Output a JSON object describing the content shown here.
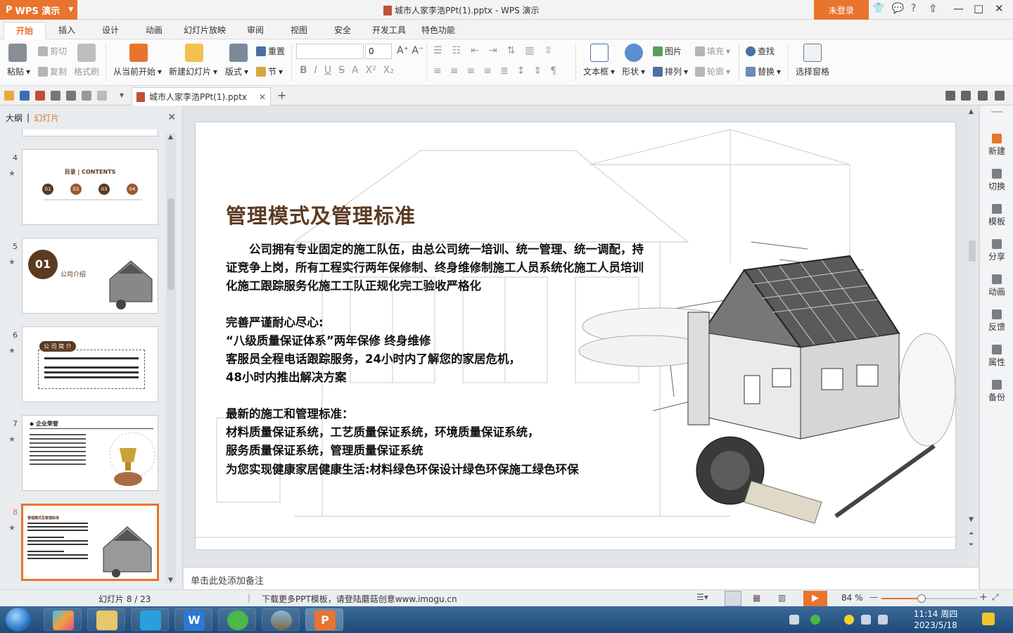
{
  "titlebar": {
    "app_name": "WPS 演示",
    "window_title": "城市人家李浩PPt(1).pptx - WPS 演示",
    "login_label": "未登录"
  },
  "tabs": [
    "开始",
    "插入",
    "设计",
    "动画",
    "幻灯片放映",
    "审阅",
    "视图",
    "安全",
    "开发工具",
    "特色功能"
  ],
  "ribbon": {
    "paste": "粘贴",
    "cut": "剪切",
    "copy": "复制",
    "format_painter": "格式刷",
    "from_current": "从当前开始",
    "new_slide": "新建幻灯片",
    "layout": "版式",
    "reset": "重置",
    "section": "节",
    "font_size": "0",
    "textbox": "文本框",
    "shape": "形状",
    "picture": "图片",
    "arrange": "排列",
    "fill": "填充",
    "outline": "轮廓",
    "find": "查找",
    "replace": "替换",
    "selection_pane": "选择窗格"
  },
  "doc_tab": {
    "name": "城市人家李浩PPt(1).pptx"
  },
  "left_panel": {
    "tab_outline": "大纲",
    "tab_slides": "幻灯片",
    "slides": [
      {
        "num": "4",
        "title": "目录 | CONTENTS",
        "items": [
          "01",
          "02",
          "03",
          "04"
        ]
      },
      {
        "num": "5",
        "title": "公司介绍",
        "badge": "01"
      },
      {
        "num": "6",
        "title": "公 司 简 介"
      },
      {
        "num": "7",
        "title": "企业荣誉"
      },
      {
        "num": "8",
        "title": "管理模式及管理标准"
      }
    ]
  },
  "slide": {
    "title": "管理模式及管理标准",
    "lines": [
      "　　公司拥有专业固定的施工队伍，由总公司统一培训、统一管理、统一调配，持",
      "证竞争上岗，所有工程实行两年保修制、终身维修制施工人员系统化施工人员培训",
      "化施工跟踪服务化施工工队正规化完工验收严格化",
      "完善严谨耐心尽心:",
      "“八级质量保证体系”两年保修 终身维修",
      "客服员全程电话跟踪服务，24小时内了解您的家居危机，",
      "48小时内推出解决方案",
      "最新的施工和管理标准：",
      "材料质量保证系统，工艺质量保证系统，环境质量保证系统，",
      "服务质量保证系统，管理质量保证系统",
      "为您实现健康家居健康生活:材料绿色环保设计绿色环保施工绿色环保"
    ]
  },
  "notes_placeholder": "单击此处添加备注",
  "right_sidebar": [
    "新建",
    "切换",
    "模板",
    "分享",
    "动画",
    "反馈",
    "属性",
    "备份"
  ],
  "statusbar": {
    "slide_counter": "幻灯片 8 / 23",
    "message": "下载更多PPT模板，请登陆蘑菇创意www.imogu.cn",
    "zoom": "84 %",
    "zoom_fraction": 0.42
  },
  "taskbar": {
    "time": "11:14 周四",
    "date": "2023/5/18"
  },
  "colors": {
    "accent": "#e8742e",
    "title_brown": "#5b3a22"
  }
}
